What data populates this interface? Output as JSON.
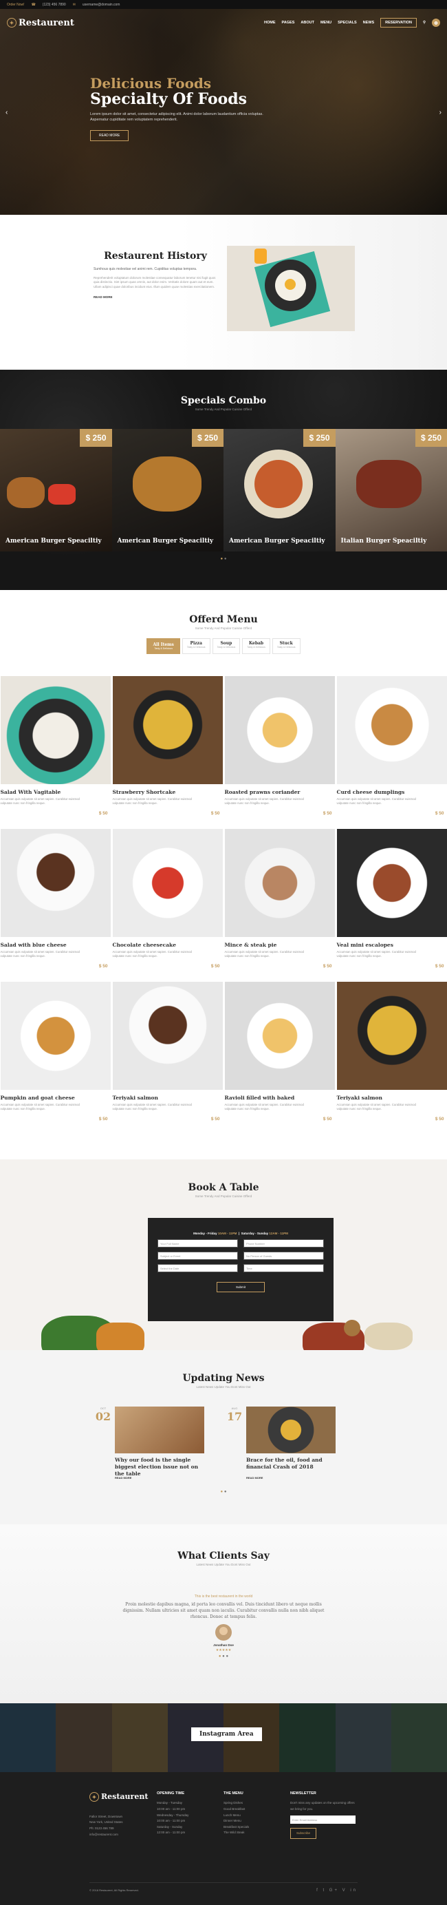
{
  "topbar": {
    "hours": "Order Now!",
    "phone": "(123) 456 7890",
    "email": "username@domain.com"
  },
  "header": {
    "logo": "Restaurent",
    "menu": [
      "Home",
      "Pages",
      "About",
      "Menu",
      "Specials",
      "News"
    ],
    "reservation": "Reservation"
  },
  "hero": {
    "title1": "Delicious Foods",
    "title2": "Specialty Of Foods",
    "text": "Lorem ipsum dolor sit amet, consectetur adipiscing elit. Animi dolor laborum laudantium officia voluptas. Aspernatur cupiditate rem voluptatem reprehenderit.",
    "button": "Read More"
  },
  "history": {
    "title": "Restaurent History",
    "lead": "Sumhous quis molestiae vel animi rem. Cupiditas voluptas tempora.",
    "para": "Reprehenderit voluptatum dolorum molestiae consequatur laborum tenetur nisi fugit quos quia distinctio. Sint ipsum quas omnis, aut dolor enim. Veritatis dolore quam aut et eum. Ullam adipisci quae doloribus incidunt eius. Illum quidem quae molestias exercitationem.",
    "button": "Read More"
  },
  "specials": {
    "title": "Specials Combo",
    "subtitle": "Some Trendy And Popular Cuisine Offerd",
    "items": [
      {
        "name": "American Burger Speaciltiy",
        "price": "$ 250"
      },
      {
        "name": "American Burger Speaciltiy",
        "price": "$ 250"
      },
      {
        "name": "American Burger Speaciltiy",
        "price": "$ 250"
      },
      {
        "name": "Italian Burger Speaciltiy",
        "price": "$ 250"
      }
    ]
  },
  "offered": {
    "title": "Offerd Menu",
    "subtitle": "Some Trendy And Popular Cuisine Offerd",
    "tabs": [
      {
        "label": "All Items",
        "sub": "Tasty & Delicious"
      },
      {
        "label": "Pizza",
        "sub": "Tasty & Delicious"
      },
      {
        "label": "Soup",
        "sub": "Tasty & Delicious"
      },
      {
        "label": "Kebab",
        "sub": "Tasty & Delicious"
      },
      {
        "label": "Stuck",
        "sub": "Tasty & Delicious"
      }
    ],
    "desc": "Accumsan quis vulputate sit amet sapien. Curabitur euismod vulputate nunc non fringilla neque.",
    "items": [
      {
        "name": "Salad With Vagitable",
        "price": "$ 50"
      },
      {
        "name": "Strawberry Shortcake",
        "price": "$ 50"
      },
      {
        "name": "Roasted prawns coriander",
        "price": "$ 50"
      },
      {
        "name": "Curd cheese dumplings",
        "price": "$ 50"
      },
      {
        "name": "Salad with blue cheese",
        "price": "$ 50"
      },
      {
        "name": "Chocolate cheesecake",
        "price": "$ 50"
      },
      {
        "name": "Mince & steak pie",
        "price": "$ 50"
      },
      {
        "name": "Veal mini escalopes",
        "price": "$ 50"
      },
      {
        "name": "Pumpkin and goat cheese",
        "price": "$ 50"
      },
      {
        "name": "Teriyaki salmon",
        "price": "$ 50"
      },
      {
        "name": "Ravioli filled with baked",
        "price": "$ 50"
      },
      {
        "name": "Teriyaki salmon",
        "price": "$ 50"
      }
    ]
  },
  "book": {
    "title": "Book A Table",
    "subtitle": "Some Trendy And Popular Cuisine Offerd",
    "hours_label": "Monday - Friday",
    "hours1": "10AM - 11PM",
    "hours_label2": "Saturday - Sunday",
    "hours2": "12AM - 11PM",
    "fields": [
      "Your Full Name",
      "Phone Number",
      "Subject or Event",
      "No Person of Guests",
      "Select the Date",
      "Time"
    ],
    "submit": "Submit"
  },
  "news": {
    "title": "Updating News",
    "subtitle": "Latest News Update You Dont Miss Out",
    "posts": [
      {
        "month": "OCT",
        "day": "02",
        "title": "Why our food is the single biggest election issue not on the table",
        "more": "Read More"
      },
      {
        "month": "AUG",
        "day": "17",
        "title": "Brace for the oil, food and financial Crash of 2018",
        "more": "Read More"
      }
    ]
  },
  "clients": {
    "title": "What Clients Say",
    "subtitle": "Latest News Update You Dont Miss Out",
    "quote_title": "This is the best restaurent in the world",
    "quote": "Proin molestie dapibus magna, id porta leo convallis vel. Duis tincidunt libero ut neque mollis dignissim. Nullam ultricies sit amet quam non iaculis. Curabitur convallis nulla non nibh aliquet rhoncus. Donec at tempus felis.",
    "author": "Jonathan Doe",
    "stars": "★★★★★"
  },
  "instagram": {
    "label": "Instagram Area"
  },
  "footer": {
    "logo": "Restaurent",
    "address": [
      "Fallor Street, Downtown",
      "New York, United States"
    ],
    "phone": "Ph: 0123 456 789",
    "email": "info@restaurent.com",
    "opening": {
      "title": "Opening Time",
      "rows": [
        "Monday - Tuesday",
        "10:00 am - 11:00 pm",
        "Wednesday - Thursday",
        "10:00 am - 11:00 pm",
        "Saturday - Sunday",
        "12:00 am - 11:00 pm"
      ]
    },
    "menu": {
      "title": "The Menu",
      "items": [
        "Spring Dishes",
        "Good Breakfast",
        "Lunch Menu",
        "Dinner Menu",
        "Breakfast Specials",
        "The Wild Steak"
      ]
    },
    "newsletter": {
      "title": "Newsletter",
      "text": "Don't miss any updates on the upcoming offers we bring for you.",
      "placeholder": "Enter Email Address",
      "button": "Subscribe"
    },
    "copyright": "© 2018 Restaurent, All Rights Reserved.",
    "social": "f t G+ V in"
  },
  "colors": {
    "accent": "#c59d5f",
    "dark": "#1e1e1e"
  }
}
